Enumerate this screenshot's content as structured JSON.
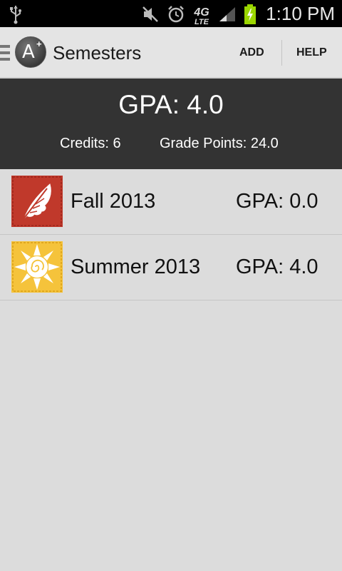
{
  "status_bar": {
    "time": "1:10 PM",
    "network_label": "4G",
    "network_sub_label": "LTE",
    "icons": [
      "usb-icon",
      "mute-icon",
      "alarm-icon",
      "network-4g-lte-icon",
      "signal-icon",
      "battery-charging-icon"
    ]
  },
  "action_bar": {
    "title": "Semesters",
    "add_label": "ADD",
    "help_label": "HELP",
    "logo_letter": "A",
    "logo_plus": "+"
  },
  "summary": {
    "gpa_text": "GPA: 4.0",
    "credits_text": "Credits: 6",
    "grade_points_text": "Grade Points: 24.0"
  },
  "semesters": [
    {
      "name": "Fall 2013",
      "gpa_text": "GPA: 0.0",
      "icon": "leaf-icon",
      "icon_color": "#c0392b"
    },
    {
      "name": "Summer 2013",
      "gpa_text": "GPA: 4.0",
      "icon": "sun-icon",
      "icon_color": "#f5c33b"
    }
  ],
  "colors": {
    "summary_background": "#333333",
    "page_background": "#dcdcdc",
    "battery_accent": "#9bd600"
  }
}
